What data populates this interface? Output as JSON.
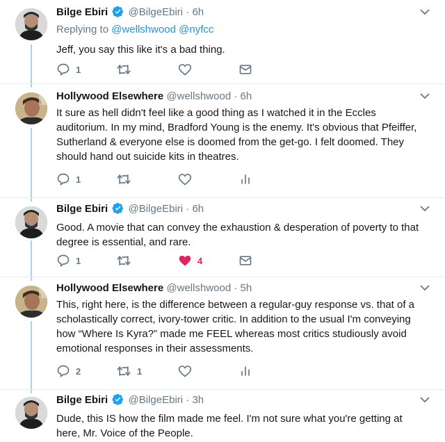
{
  "tweets": [
    {
      "name": "Bilge Ebiri",
      "handle": "@BilgeEbiri",
      "sep": "·",
      "time": "6h",
      "reply_prefix": "Replying to",
      "reply_mentions": "@wellshwood @nyfcc",
      "text": "Jeff, you say this like it's a bad thing.",
      "replies": "1",
      "retweets": "",
      "likes": ""
    },
    {
      "name": "Hollywood Elsewhere",
      "handle": "@wellshwood",
      "sep": "·",
      "time": "6h",
      "text": "It sure as hell didn't feel like a good thing as I watched it in the Eccles auditorium.  In my mind, Bradford Young is the enemy.  It's obvious that  Pfeiffer, Sutherland & everyone else is doomed from the get-go.  I felt doomed.  They should hand out suicide kits in theatres.",
      "replies": "1",
      "retweets": "",
      "likes": ""
    },
    {
      "name": "Bilge Ebiri",
      "handle": "@BilgeEbiri",
      "sep": "·",
      "time": "6h",
      "text": "Good. A movie that can convey the exhaustion & desperation of poverty to that degree is essential, and rare.",
      "replies": "1",
      "retweets": "",
      "likes": "4"
    },
    {
      "name": "Hollywood Elsewhere",
      "handle": "@wellshwood",
      "sep": "·",
      "time": "5h",
      "text": "This, right here, is the difference between a regular-guy response vs. that of a scholastically correct, ivory-tower critic. In addition to the usual I'm conveying how “Where Is Kyra?” made me FEEL whereas most critics studiously avoid emotional responses in their assessments.",
      "replies": "2",
      "retweets": "1",
      "likes": ""
    },
    {
      "name": "Bilge Ebiri",
      "handle": "@BilgeEbiri",
      "sep": "·",
      "time": "3h",
      "text": "Dude, this IS how the film made me feel. I'm not sure what you're getting at here, Mr. Voice of the People."
    }
  ],
  "colors": {
    "thread_line": "#9fd6f6",
    "verified": "#1da1f2",
    "like_active": "#e0245e",
    "icon_gray": "#657786"
  },
  "icons": [
    "verified-badge-icon",
    "chevron-down-icon",
    "reply-icon",
    "retweet-icon",
    "like-icon",
    "message-icon",
    "analytics-icon"
  ]
}
